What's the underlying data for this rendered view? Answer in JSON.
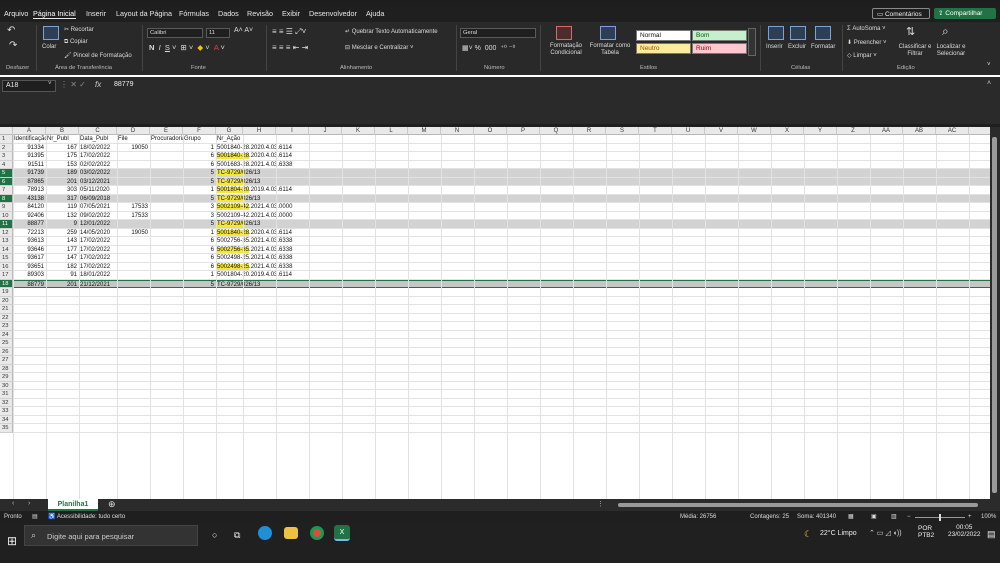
{
  "menu": {
    "tabs": [
      "Arquivo",
      "Página Inicial",
      "Inserir",
      "Layout da Página",
      "Fórmulas",
      "Dados",
      "Revisão",
      "Exibir",
      "Desenvolvedor",
      "Ajuda"
    ],
    "comments": "Comentários",
    "share": "Compartilhar"
  },
  "ribbon": {
    "undo_group": "Desfazer",
    "clipboard": {
      "paste": "Colar",
      "cut": "Recortar",
      "copy": "Copiar",
      "painter": "Pincel de Formatação",
      "title": "Área de Transferência"
    },
    "font": {
      "name": "Calibri",
      "size": "11",
      "title": "Fonte"
    },
    "alignment": {
      "wrap": "Quebrar Texto Automaticamente",
      "merge": "Mesclar e Centralizar",
      "title": "Alinhamento"
    },
    "number": {
      "format": "Geral",
      "title": "Número"
    },
    "styles": {
      "conditional": "Formatação Condicional",
      "as_table": "Formatar como Tabela",
      "normal": "Normal",
      "good": "Bom",
      "neutral": "Neutro",
      "bad": "Ruim",
      "title": "Estilos"
    },
    "cells": {
      "insert": "Inserir",
      "delete": "Excluir",
      "format": "Formatar",
      "title": "Células"
    },
    "editing": {
      "autosum": "AutoSoma",
      "fill": "Preencher",
      "clear": "Limpar",
      "sort": "Classificar e Filtrar",
      "find": "Localizar e Selecionar",
      "title": "Edição"
    },
    "colors": {
      "accent": "#217346",
      "bom": "#c6efce",
      "neutro": "#ffeb9c",
      "ruim": "#ffc7ce"
    }
  },
  "formula_bar": {
    "name_box": "A18",
    "fx": "fx",
    "content": "88779"
  },
  "columns": [
    "A",
    "B",
    "C",
    "D",
    "E",
    "F",
    "G",
    "H",
    "I",
    "J",
    "K",
    "L",
    "M",
    "N",
    "O",
    "P",
    "Q",
    "R",
    "S",
    "T",
    "U",
    "V",
    "W",
    "X",
    "Y",
    "Z",
    "AA",
    "AB",
    "AC"
  ],
  "headers": [
    "Identificação",
    "Nr_Publ",
    "Data_Publ",
    "File",
    "Procuradoria",
    "Grupo",
    "Nr_Ação"
  ],
  "rows": [
    {
      "n": "2",
      "a": "91334",
      "b": "167",
      "c": "18/02/2022",
      "d": "19050",
      "f": "1",
      "g1": "5001840-28.2020.4.03.6114",
      "g2": ""
    },
    {
      "n": "3",
      "a": "91395",
      "b": "175",
      "c": "17/02/2022",
      "d": "",
      "f": "6",
      "g1": "5001840-28",
      "g2": ".2020.4.03.6114"
    },
    {
      "n": "4",
      "a": "91511",
      "b": "153",
      "c": "02/02/2022",
      "d": "",
      "f": "6",
      "g1": "5001683-28.2021.4.03.6338",
      "g2": ""
    },
    {
      "n": "5",
      "a": "91739",
      "b": "189",
      "c": "03/02/2022",
      "d": "",
      "f": "5",
      "g1": "TC-9729/0",
      "g2": "26/13"
    },
    {
      "n": "6",
      "a": "87865",
      "b": "201",
      "c": "03/12/2021",
      "d": "",
      "f": "5",
      "g1": "TC-9729/0",
      "g2": "26/13"
    },
    {
      "n": "7",
      "a": "78913",
      "b": "303",
      "c": "05/11/2020",
      "d": "",
      "f": "1",
      "g1": "5001804-20",
      "g2": ".2019.4.03.6114"
    },
    {
      "n": "8",
      "a": "43138",
      "b": "317",
      "c": "06/09/2018",
      "d": "",
      "f": "5",
      "g1": "TC-9729/0",
      "g2": "26/13"
    },
    {
      "n": "9",
      "a": "84120",
      "b": "119",
      "c": "07/05/2021",
      "d": "17533",
      "f": "3",
      "g1": "5002109-42",
      "g2": ".2021.4.03.0000"
    },
    {
      "n": "10",
      "a": "92406",
      "b": "132",
      "c": "09/02/2022",
      "d": "17533",
      "f": "3",
      "g1": "5002109-42.2021.4.03.0000",
      "g2": ""
    },
    {
      "n": "11",
      "a": "88877",
      "b": "9",
      "c": "12/01/2022",
      "d": "",
      "f": "5",
      "g1": "TC-9729/0",
      "g2": "26/13"
    },
    {
      "n": "12",
      "a": "72213",
      "b": "259",
      "c": "14/05/2020",
      "d": "19050",
      "f": "1",
      "g1": "5001840-28",
      "g2": ".2020.4.03.6114"
    },
    {
      "n": "13",
      "a": "93613",
      "b": "143",
      "c": "17/02/2022",
      "d": "",
      "f": "6",
      "g1": "5002756-35.2021.4.03.6338",
      "g2": ""
    },
    {
      "n": "14",
      "a": "93646",
      "b": "177",
      "c": "17/02/2022",
      "d": "",
      "f": "6",
      "g1": "5002756-35",
      "g2": ".2021.4.03.6338"
    },
    {
      "n": "15",
      "a": "93617",
      "b": "147",
      "c": "17/02/2022",
      "d": "",
      "f": "6",
      "g1": "5002498-25.2021.4.03.6338",
      "g2": ""
    },
    {
      "n": "16",
      "a": "93651",
      "b": "182",
      "c": "17/02/2022",
      "d": "",
      "f": "6",
      "g1": "5002498-25",
      "g2": ".2021.4.03.6338"
    },
    {
      "n": "17",
      "a": "89303",
      "b": "91",
      "c": "18/01/2022",
      "d": "",
      "f": "1",
      "g1": "5001804-20.2019.4.03.6114",
      "g2": ""
    },
    {
      "n": "18",
      "a": "88779",
      "b": "201",
      "c": "21/12/2021",
      "d": "",
      "f": "5",
      "g1": "TC-9729/026/13",
      "g2": ""
    }
  ],
  "sheet_tab": "Planilha1",
  "status": {
    "ready": "Pronto",
    "accessibility": "Acessibilidade: tudo certo",
    "average": "Média: 26756",
    "count": "Contagens: 25",
    "sum": "Soma: 401340",
    "zoom": "100%"
  },
  "taskbar": {
    "search": "Digite aqui para pesquisar",
    "weather": "22°C  Limpo",
    "lang1": "POR",
    "lang2": "PTB2",
    "time": "00:05",
    "date": "23/02/2022"
  }
}
